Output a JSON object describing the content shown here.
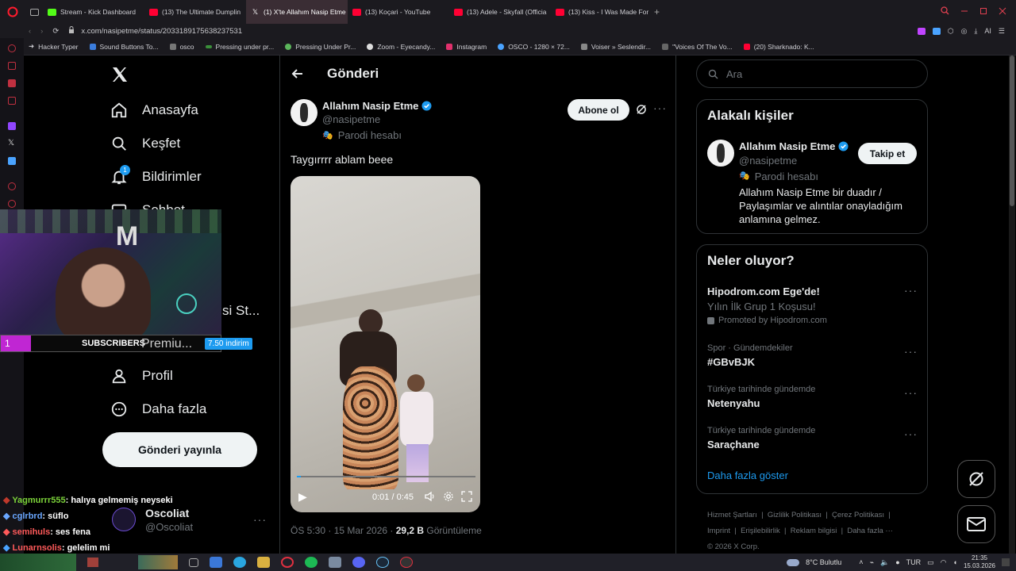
{
  "browser": {
    "tabs": [
      {
        "label": "Stream - Kick Dashboard",
        "color": "#53fc18"
      },
      {
        "label": "(13) The Ultimate Dumplin",
        "color": "#ff0033"
      },
      {
        "label": "(1) X'te Allahım Nasip Etme",
        "color": "#ffffff"
      },
      {
        "label": "(13) Koçari - YouTube",
        "color": "#ff0033"
      },
      {
        "label": "(13) Adele - Skyfall (Officia",
        "color": "#ff0033"
      },
      {
        "label": "(13) Kiss - I Was Made For",
        "color": "#ff0033"
      }
    ],
    "url": "x.com/nasipetme/status/2033189175638237531",
    "url_domain": "x.com",
    "bookmarks": [
      "Hacker Typer",
      "Sound Buttons To...",
      "osco",
      "Pressing under pr...",
      "Pressing Under Pr...",
      "Zoom - Eyecandy...",
      "Instagram",
      "OSCO - 1280 × 72...",
      "Voiser » Seslendir...",
      "\"Voices Of The Vo...",
      "(20) Sharknado: K..."
    ]
  },
  "nav": {
    "home": "Anasayfa",
    "explore": "Keşfet",
    "notifications": "Bildirimler",
    "notif_count": "1",
    "chat_partial": "Sohbet",
    "premium_partial": "si St...",
    "premium": "Premiu...",
    "discount": "7.50 indirim",
    "profile": "Profil",
    "more": "Daha fazla",
    "post_button": "Gönderi yayınla",
    "account_name": "Oscoliat",
    "account_handle": "@Oscoliat"
  },
  "stream": {
    "sub_count": "1",
    "subs_label": "SUBSCRIBERS",
    "chat": [
      {
        "user": "Yagmurrr555",
        "msg": ": halıya gelmemiş neyseki",
        "color": "#7cd33a"
      },
      {
        "user": "cglrbrd",
        "msg": ": süflo",
        "color": "#6aa7ff"
      },
      {
        "user": "semihuls",
        "msg": ": ses fena",
        "color": "#ff5a5a"
      },
      {
        "user": "Lunarnsolis",
        "msg": ": gelelim mi",
        "color": "#ff5a5a"
      }
    ]
  },
  "post": {
    "header": "Gönderi",
    "author": "Allahım Nasip Etme",
    "handle": "@nasipetme",
    "parody": "Parodi hesabı",
    "subscribe": "Abone ol",
    "text": "Taygırrrr ablam beee",
    "video_time": "0:01 / 0:45",
    "video_progress": 0.02,
    "timestamp": "ÖS 5:30 · 15 Mar 2026 · ",
    "views_count": "29,2 B",
    "views_label": " Görüntüleme"
  },
  "sidebar": {
    "search_placeholder": "Ara",
    "related_title": "Alakalı kişiler",
    "related": {
      "name": "Allahım Nasip Etme",
      "handle": "@nasipetme",
      "parody": "Parodi hesabı",
      "follow": "Takip et",
      "bio": "Allahım Nasip Etme bir duadır / Paylaşımlar ve alıntılar onayladığım anlamına gelmez."
    },
    "trends_title": "Neler oluyor?",
    "trends": [
      {
        "context": "",
        "title": "Hipodrom.com Ege'de!",
        "sub": "Yılın İlk Grup 1 Koşusu!",
        "promo": "Promoted by Hipodrom.com"
      },
      {
        "context": "Spor · Gündemdekiler",
        "title": "#GBvBJK",
        "sub": "",
        "promo": ""
      },
      {
        "context": "Türkiye tarihinde gündemde",
        "title": "Netenyahu",
        "sub": "",
        "promo": ""
      },
      {
        "context": "Türkiye tarihinde gündemde",
        "title": "Saraçhane",
        "sub": "",
        "promo": ""
      }
    ],
    "show_more": "Daha fazla göster",
    "footer": [
      "Hizmet Şartları",
      "Gizlilik Politikası",
      "Çerez Politikası",
      "Imprint",
      "Erişilebilirlik",
      "Reklam bilgisi",
      "Daha fazla ···"
    ],
    "copyright": "© 2026 X Corp."
  },
  "taskbar": {
    "weather": "8°C  Bulutlu",
    "lang": "TUR",
    "time": "21:35",
    "date": "15.03.2026"
  }
}
